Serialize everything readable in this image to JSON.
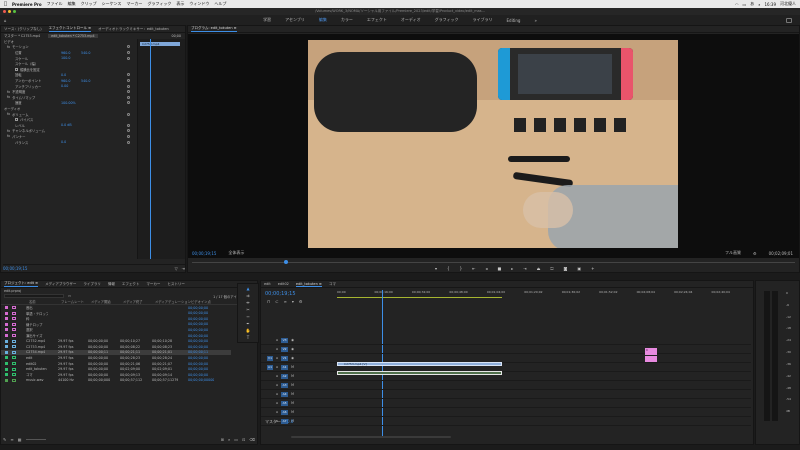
{
  "menubar": {
    "apple": "",
    "app_name": "Premiere Pro",
    "items": [
      "ファイル",
      "編集",
      "クリップ",
      "シーケンス",
      "マーカー",
      "グラフィック",
      "表示",
      "ウィンドウ",
      "ヘルプ"
    ],
    "user": "あ",
    "clock": "16:39",
    "username": "河北優人"
  },
  "title_bar": {
    "path": "/Volumes/WORK_3/NOMA/ソーシャル用ファイル/Premiere_2023/edit/学習/Product_video/edit_mas..."
  },
  "workspaces": {
    "items": [
      "学習",
      "アセンブリ",
      "編集",
      "カラー",
      "エフェクト",
      "オーディオ",
      "グラフィック",
      "ライブラリ",
      "Editing"
    ],
    "active_index": 2
  },
  "effect_controls": {
    "tabs": [
      "ソース：(クリップなし)",
      "エフェクトコントロール ≡",
      "オーディオトラックミキサー：edit_tokuten"
    ],
    "master": "マスター * C2753.mp4",
    "sequence": "edit_tokuten * C2753.mp4",
    "mini_clip": "C2753.mp4",
    "mini_time": "00;00",
    "sections": [
      {
        "label": "ビデオ",
        "type": "header"
      },
      {
        "label": "モーション",
        "type": "group"
      },
      {
        "label": "位置",
        "value": "960.0",
        "value2": "540.0",
        "type": "prop"
      },
      {
        "label": "スケール",
        "value": "100.0",
        "type": "prop"
      },
      {
        "label": "スケール（幅）",
        "value": "",
        "type": "prop-dim"
      },
      {
        "label": "縦横比を固定",
        "value": "",
        "type": "check"
      },
      {
        "label": "回転",
        "value": "0.0",
        "type": "prop"
      },
      {
        "label": "アンカーポイント",
        "value": "960.0",
        "value2": "540.0",
        "type": "prop"
      },
      {
        "label": "アンチフリッカー",
        "value": "0.00",
        "type": "prop"
      },
      {
        "label": "不透明度",
        "type": "group"
      },
      {
        "label": "タイムリマップ",
        "type": "group"
      },
      {
        "label": "速度",
        "value": "100.00%",
        "type": "prop"
      },
      {
        "label": "オーディオ",
        "type": "header"
      },
      {
        "label": "ボリューム",
        "type": "group"
      },
      {
        "label": "バイパス",
        "value": "",
        "type": "check"
      },
      {
        "label": "レベル",
        "value": "0.0 dB",
        "type": "prop"
      },
      {
        "label": "チャンネルボリューム",
        "type": "group"
      },
      {
        "label": "パンナー",
        "type": "group"
      },
      {
        "label": "バランス",
        "value": "0.0",
        "type": "prop"
      }
    ],
    "bottom_time": "00;00;19;15"
  },
  "program_monitor": {
    "tab": "プログラム: edit_tokuten ≡",
    "timecode": "00;00;19;15",
    "fit": "全体表示",
    "quality": "フル画質",
    "duration": "00;02;09;01"
  },
  "project_panel": {
    "tabs": [
      "プロジェクト: edit ≡",
      "メディアブラウザー",
      "ライブラリ",
      "情報",
      "エフェクト",
      "マーカー",
      "ヒストリー"
    ],
    "project_file": "edit.prproj",
    "selection_info": "1 / 17 個のアイテムを選択",
    "columns": [
      "名前",
      "フレームレート",
      "メディア開始",
      "メディア終了",
      "メディアデュレーション",
      "ビデオイン点"
    ],
    "items": [
      {
        "color": "#d56bd1",
        "name": "音出",
        "fps": "",
        "start": "",
        "end": "",
        "dur": "",
        "vin": "00;00;00;00"
      },
      {
        "color": "#d56bd1",
        "name": "単語・テロップ",
        "fps": "",
        "start": "",
        "end": "",
        "dur": "",
        "vin": "00;00;00;00"
      },
      {
        "color": "#d56bd1",
        "name": "枠",
        "fps": "",
        "start": "",
        "end": "",
        "dur": "",
        "vin": "00;00;00;00"
      },
      {
        "color": "#d56bd1",
        "name": "線テロップ",
        "fps": "",
        "start": "",
        "end": "",
        "dur": "",
        "vin": "00;00;00;00"
      },
      {
        "color": "#d56bd1",
        "name": "選択",
        "fps": "",
        "start": "",
        "end": "",
        "dur": "",
        "vin": "00;00;00;00"
      },
      {
        "color": "#d56bd1",
        "name": "演出サイズ",
        "fps": "",
        "start": "",
        "end": "",
        "dur": "",
        "vin": "00;00;00;00"
      },
      {
        "color": "#6ab0de",
        "name": "C2752.mp4",
        "fps": "29.97 fps",
        "start": "00;00;00;00",
        "end": "00;00;10;27",
        "dur": "00;00;10;28",
        "vin": "00;00;00;00"
      },
      {
        "color": "#6ab0de",
        "name": "C2753.mp4",
        "fps": "29.97 fps",
        "start": "00;00;00;00",
        "end": "00;00;08;22",
        "dur": "00;00;08;23",
        "vin": "00;00;00;00"
      },
      {
        "color": "#6ab0de",
        "name": "C2754.mp4",
        "fps": "29.97 fps",
        "start": "00;00;00;11",
        "end": "00;00;21;11",
        "dur": "00;00;21;01",
        "vin": "00;00;00;11"
      },
      {
        "color": "#2fbf6d",
        "name": "edit",
        "fps": "29.97 fps",
        "start": "00;00;00;00",
        "end": "00;00;28;23",
        "dur": "00;00;28;24",
        "vin": "00;00;00;00"
      },
      {
        "color": "#2fbf6d",
        "name": "edit02",
        "fps": "29.97 fps",
        "start": "00;00;00;00",
        "end": "00;00;21;06",
        "dur": "00;00;21;07",
        "vin": "00;00;00;00"
      },
      {
        "color": "#2fbf6d",
        "name": "edit_tokuten",
        "fps": "29.97 fps",
        "start": "00;00;00;00",
        "end": "00;02;09;00",
        "dur": "00;02;09;01",
        "vin": "00;00;00;00"
      },
      {
        "color": "#2fbf6d",
        "name": "コマ",
        "fps": "29.97 fps",
        "start": "00;00;00;00",
        "end": "00;00;09;13",
        "dur": "00;00;09;14",
        "vin": "00;00;00;00"
      },
      {
        "color": "#50a050",
        "name": "music.wav",
        "fps": "44100 Hz",
        "start": "00;00;00;00000",
        "end": "00;00;57;11279",
        "dur": "00;00;57;11279",
        "vin": "00;00;00;00000"
      }
    ],
    "selected_index": 8
  },
  "timeline": {
    "tabs": [
      "edit",
      "edit02",
      "edit_tokuten ≡",
      "コマ"
    ],
    "active_tab": 2,
    "timecode": "00;00;19;15",
    "ruler": [
      "00;00",
      "00;00;16;00",
      "00;00;32;00",
      "00;00;48;00",
      "00;01;04;00",
      "00;01;20;02",
      "00;01;36;02",
      "00;01;52;02",
      "00;02;08;04",
      "00;02;24;04",
      "00;02;40;04"
    ],
    "video_tracks": [
      "V3",
      "V2",
      "V1"
    ],
    "audio_tracks": [
      "A1",
      "A2",
      "A3",
      "A4",
      "A5",
      "A6",
      "A7"
    ],
    "src_v": "V1",
    "src_a": "A1",
    "master": "マスター",
    "master_val": "0.0",
    "clip_v1": "C2753.mp4 [V]",
    "clip_a1": "",
    "side_clip": "C"
  },
  "meter": {
    "labels": [
      "0",
      "-6",
      "-12",
      "-18",
      "-24",
      "-30",
      "-36",
      "-42",
      "-48",
      "-54",
      "dB"
    ]
  }
}
